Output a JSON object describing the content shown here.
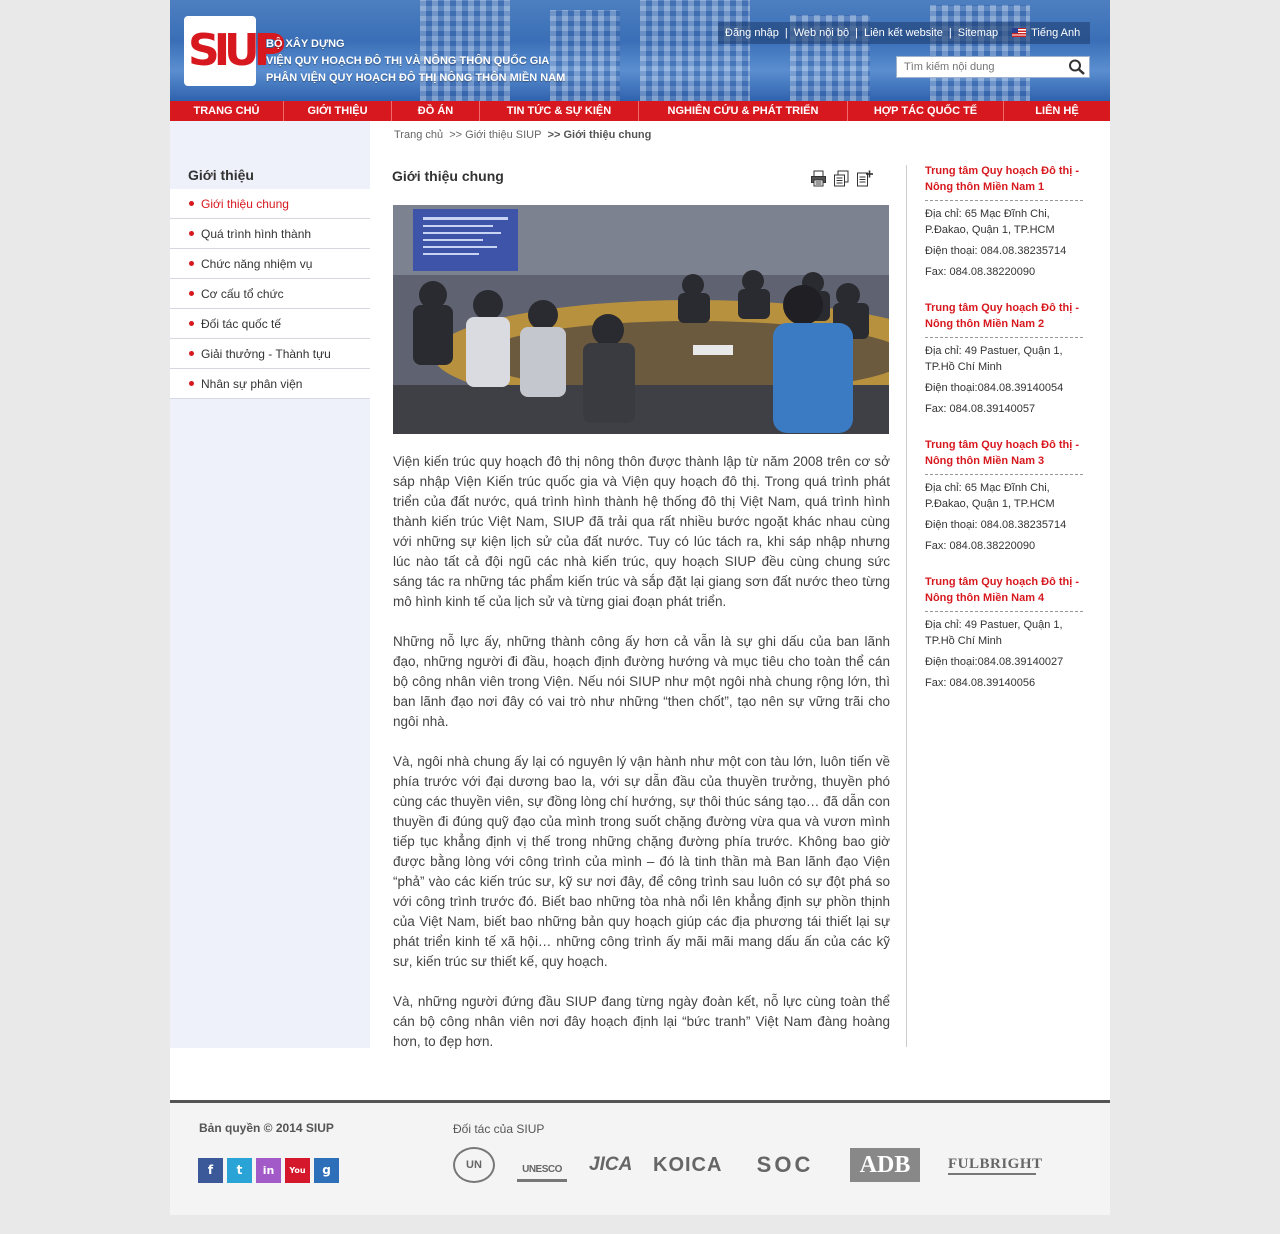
{
  "header": {
    "logo_text": "SIUP",
    "org_lines": [
      "BỘ XÂY DỰNG",
      "VIỆN QUY HOẠCH ĐÔ THỊ VÀ NÔNG THÔN QUỐC GIA",
      "PHÂN VIỆN QUY HOẠCH ĐÔ THỊ NÔNG THÔN MIỀN NAM"
    ],
    "links": [
      "Đăng nhập",
      "Web nội bộ",
      "Liên kết website",
      "Sitemap"
    ],
    "language": "Tiếng Anh",
    "search_placeholder": "Tìm kiếm nội dung"
  },
  "nav": [
    "TRANG CHỦ",
    "GIỚI THIỆU",
    "ĐỒ ÁN",
    "TIN TỨC & SỰ KIỆN",
    "NGHIÊN CỨU & PHÁT TRIỂN",
    "HỢP TÁC QUỐC TẾ",
    "LIÊN HỆ"
  ],
  "breadcrumb": [
    "Trang chủ",
    ">> Giới thiệu SIUP",
    ">> Giới thiệu chung"
  ],
  "sidebar": {
    "title": "Giới thiệu",
    "items": [
      "Giới thiệu chung",
      "Quá trình hình thành",
      "Chức năng nhiệm vụ",
      "Cơ cấu tổ chức",
      "Đối tác quốc tế",
      "Giải thưởng - Thành tựu",
      "Nhân sự phân viện"
    ]
  },
  "main": {
    "title": "Giới thiệu chung",
    "paragraphs": [
      "Viện kiến trúc quy hoạch đô thị nông thôn được thành lập từ năm 2008 trên cơ sở sáp nhập Viện Kiến trúc quốc gia và Viện quy hoạch đô thị. Trong quá trình phát triển của đất nước, quá trình hình thành hệ thống đô thị Việt Nam, quá trình hình thành kiến trúc Việt Nam, SIUP đã trải qua rất nhiều bước ngoặt khác nhau cùng với những sự kiện lịch sử của đất nước. Tuy có lúc tách ra, khi sáp nhập nhưng lúc nào tất cả đội ngũ các nhà kiến trúc, quy hoạch SIUP đều cùng chung sức sáng tác ra những tác phẩm kiến trúc và sắp đặt lại giang sơn đất nước theo từng mô hình kinh tế của lịch sử và từng giai đoạn phát triển.",
      "Những nỗ lực ấy, những thành công ấy hơn cả vẫn là sự ghi dấu của ban lãnh đạo, những người đi đầu, hoạch định đường hướng và mục tiêu cho toàn thể cán bộ công nhân viên trong Viện. Nếu nói SIUP như một ngôi nhà chung rộng lớn, thì ban lãnh đạo nơi đây có vai trò như những “then chốt”, tạo nên sự vững trãi cho ngôi nhà.",
      "Và, ngôi nhà chung ấy lại có nguyên lý vận hành như một con tàu lớn, luôn tiến về phía trước với đại dương bao la, với sự dẫn đầu của thuyền trưởng, thuyền phó cùng các thuyền viên, sự đồng lòng chí hướng, sự thôi thúc sáng tạo… đã dẫn con thuyền đi đúng quỹ đạo của mình trong suốt chặng đường vừa qua và vươn mình tiếp tục khẳng định vị thế trong những chặng đường phía trước. Không bao giờ được bằng lòng với công trình của mình – đó là tinh thần mà Ban lãnh đạo Viện “phả” vào các kiến trúc sư, kỹ sư nơi đây, để công trình sau luôn có sự đột phá so với công trình trước đó. Biết bao những tòa nhà nổi lên khẳng định sự phồn thịnh của Việt Nam, biết bao những bản quy hoạch giúp các địa phương tái thiết lại sự phát triển kinh tế xã hội… những công trình ấy mãi mãi mang dấu ấn của các kỹ sư, kiến trúc sư thiết kế, quy hoạch.",
      "Và, những người đứng đầu SIUP đang từng ngày đoàn kết, nỗ lực cùng toàn thể cán bộ công nhân viên nơi đây hoạch định lại “bức tranh” Việt Nam đàng hoàng hơn, to đẹp hơn."
    ]
  },
  "centers": [
    {
      "title": "Trung tâm Quy hoạch Đô thị - Nông thôn Miền Nam 1",
      "address": "Địa chỉ: 65 Mạc Đĩnh Chi, P.Đakao, Quận 1, TP.HCM",
      "phone": "Điện thoại: 084.08.38235714",
      "fax": "Fax: 084.08.38220090"
    },
    {
      "title": "Trung tâm Quy hoạch Đô thị - Nông thôn Miền Nam 2",
      "address": "Địa chỉ: 49 Pastuer, Quận 1, TP.Hồ Chí Minh",
      "phone": "Điện thoại:084.08.39140054",
      "fax": "Fax: 084.08.39140057"
    },
    {
      "title": "Trung tâm Quy hoạch Đô thị - Nông thôn Miền Nam 3",
      "address": "Địa chỉ: 65 Mạc Đĩnh Chi, P.Đakao, Quận 1, TP.HCM",
      "phone": "Điện thoại: 084.08.38235714",
      "fax": "Fax: 084.08.38220090"
    },
    {
      "title": "Trung tâm Quy hoạch Đô thị - Nông thôn Miền Nam 4",
      "address": "Địa chỉ: 49 Pastuer, Quận 1, TP.Hồ Chí Minh",
      "phone": "Điện thoại:084.08.39140027",
      "fax": "Fax: 084.08.39140056"
    }
  ],
  "footer": {
    "copyright": "Bản quyền © 2014 SIUP",
    "partners_title": "Đối tác của SIUP",
    "socials": [
      "f",
      "t",
      "in",
      "You",
      "g"
    ],
    "partners": [
      "UN",
      "UNESCO",
      "JICA",
      "KOICA",
      "SOC",
      "ADB",
      "FULBRIGHT"
    ]
  },
  "colors": {
    "brand_red": "#d7191f",
    "header_blue": "#3a6fb7",
    "sidebar_bg": "#eef1fa"
  }
}
